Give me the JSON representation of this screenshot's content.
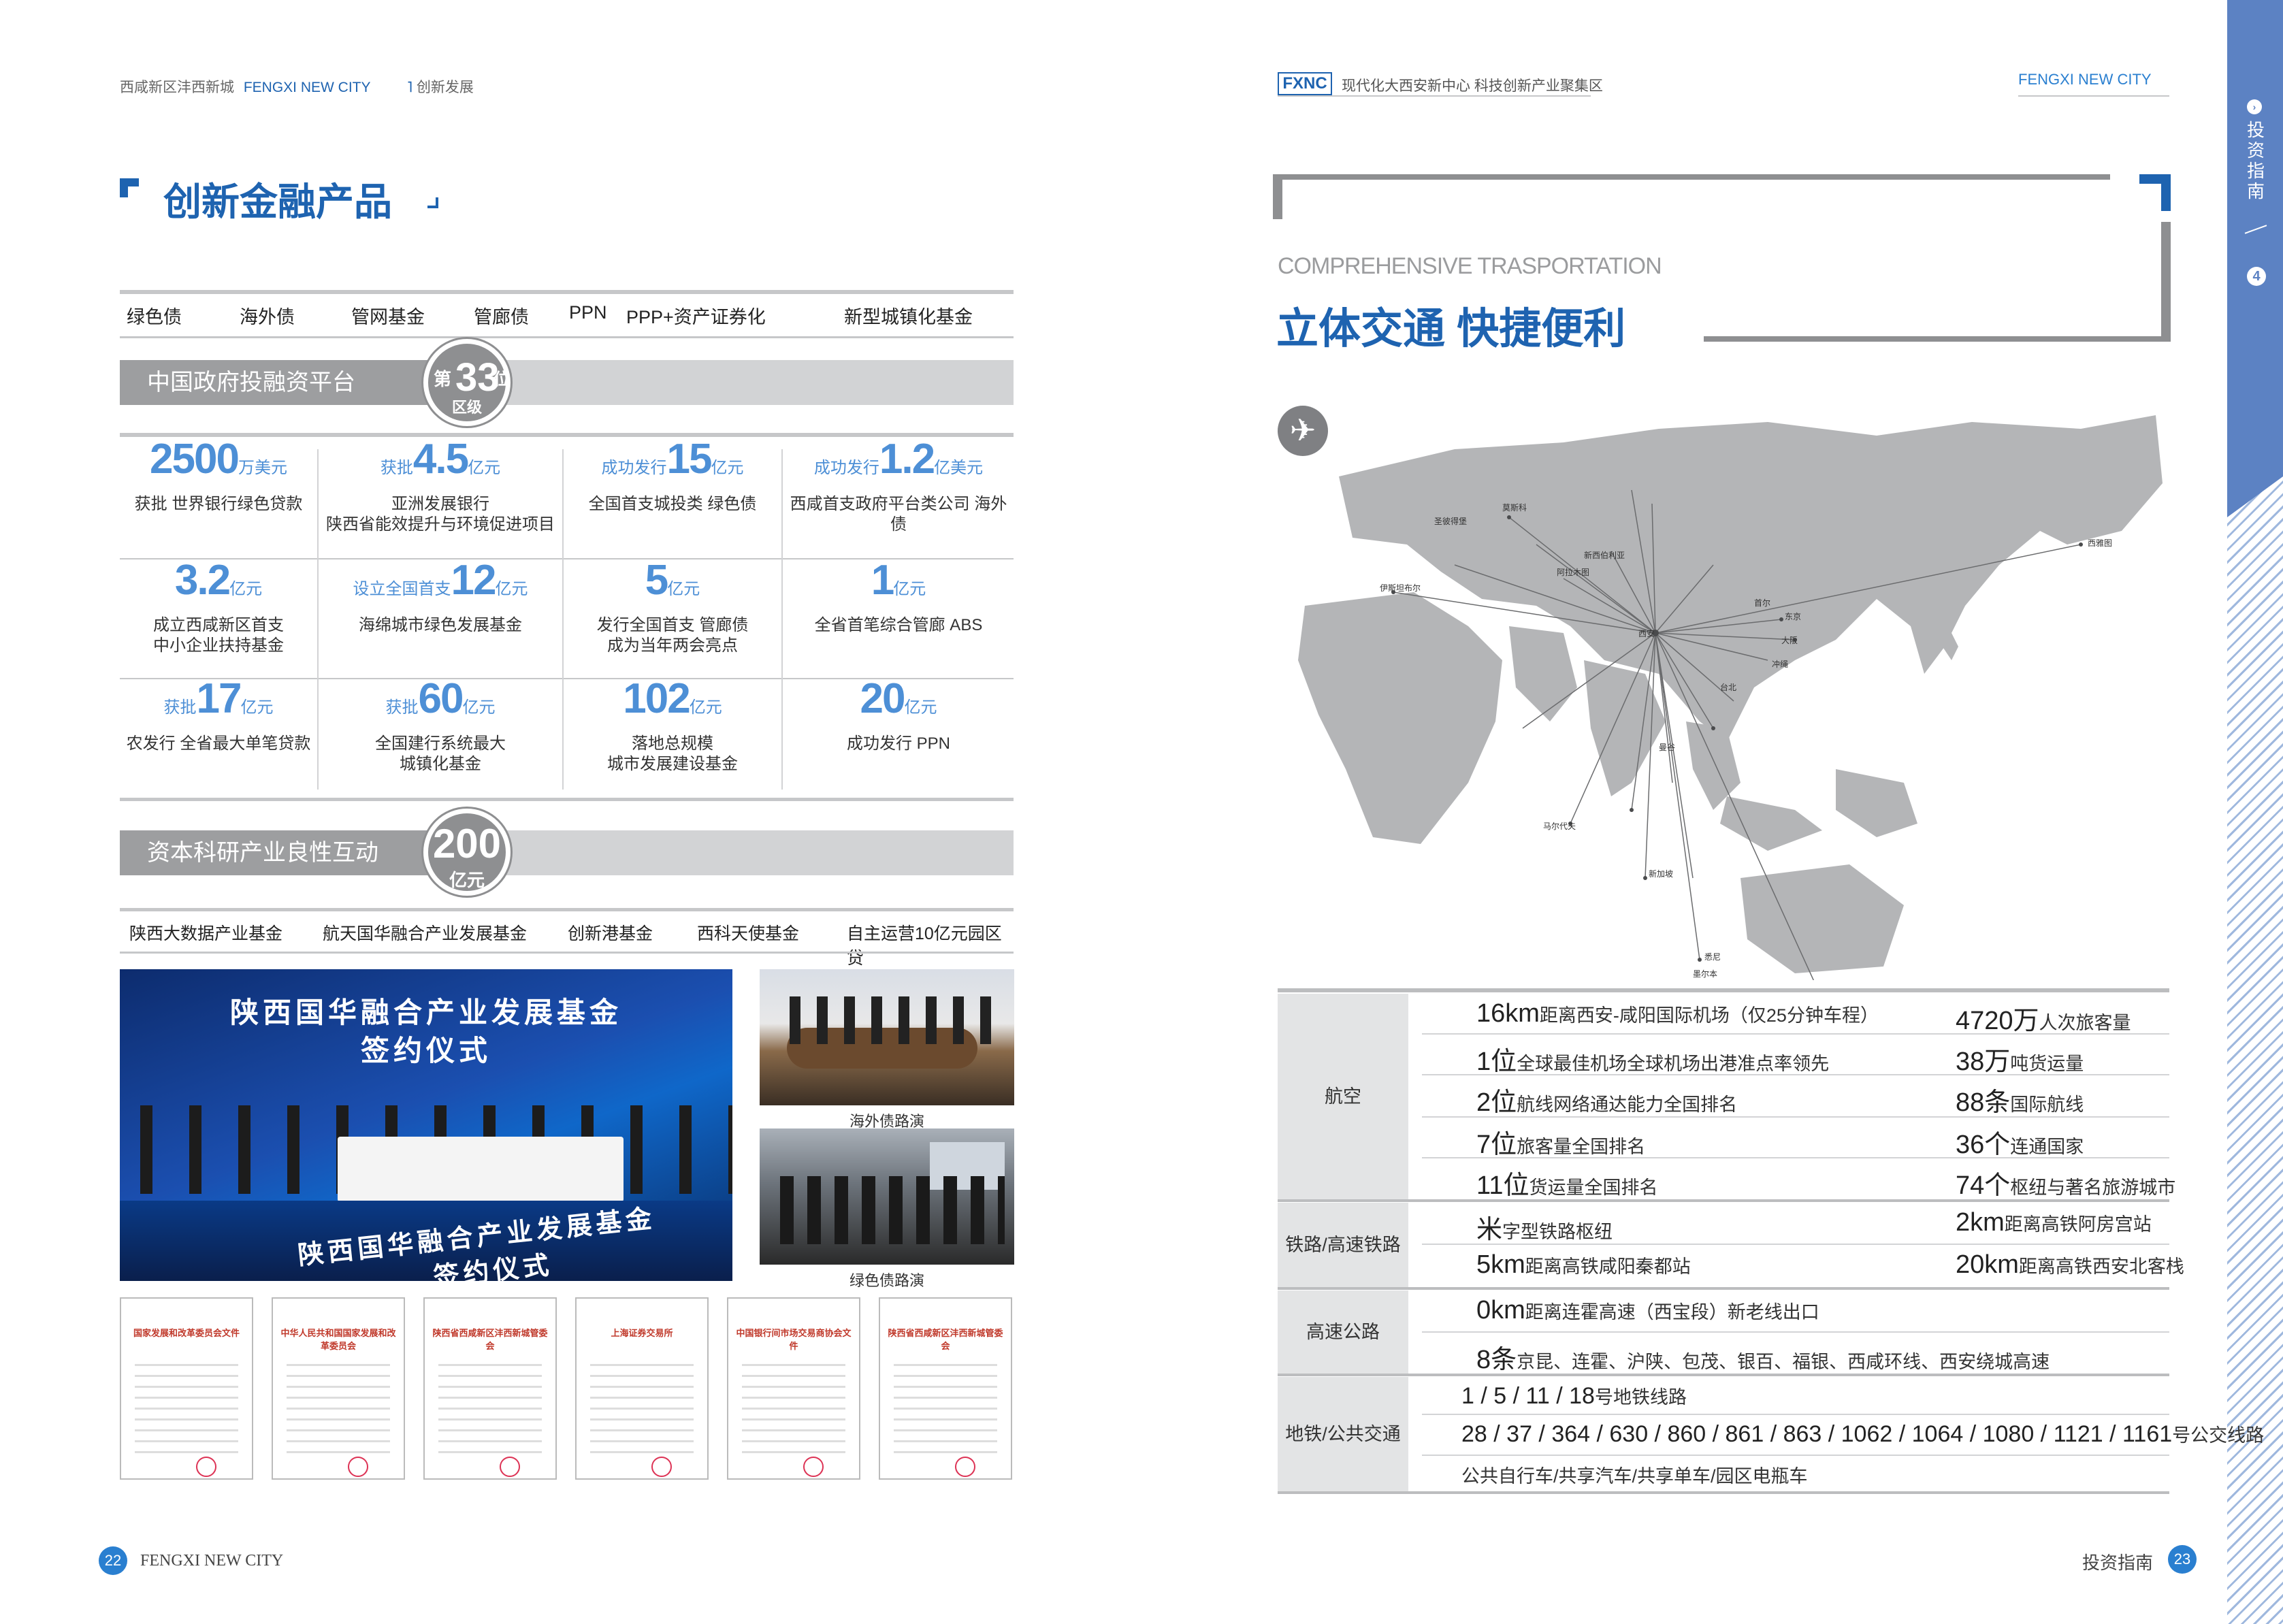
{
  "left": {
    "header": {
      "area": "西咸新区沣西新城",
      "brand": "FENGXI NEW CITY",
      "section": "创新发展"
    },
    "title": "创新金融产品",
    "tags": [
      "绿色债",
      "海外债",
      "管网基金",
      "管廊债",
      "PPN",
      "PPP+资产证券化",
      "新型城镇化基金"
    ],
    "platform": {
      "label": "中国政府投融资平台",
      "rank_prefix": "第",
      "rank": "33",
      "rank_suffix": "位",
      "rank_sub": "区级"
    },
    "stats": [
      {
        "pre": "",
        "num": "2500",
        "unit": "万美元",
        "l1": "获批 世界银行绿色贷款",
        "l2": "",
        "l3": ""
      },
      {
        "pre": "获批",
        "num": "4.5",
        "unit": "亿元",
        "l1": "亚洲发展银行",
        "l2": "陕西省能效提升与环境促进项目",
        "l3": ""
      },
      {
        "pre": "成功发行",
        "num": "15",
        "unit": "亿元",
        "l1": "全国首支城投类 绿色债",
        "l2": "",
        "l3": ""
      },
      {
        "pre": "成功发行",
        "num": "1.2",
        "unit": "亿美元",
        "l1": "西咸首支政府平台类公司 海外债",
        "l2": "",
        "l3": ""
      },
      {
        "pre": "",
        "num": "3.2",
        "unit": "亿元",
        "l1": "成立西咸新区首支",
        "l2": "中小企业扶持基金",
        "l3": ""
      },
      {
        "pre": "设立全国首支",
        "num": "12",
        "unit": "亿元",
        "l1": "海绵城市绿色发展基金",
        "l2": "",
        "l3": ""
      },
      {
        "pre": "",
        "num": "5",
        "unit": "亿元",
        "l1": "发行全国首支 管廊债",
        "l2": "成为当年两会亮点",
        "l3": ""
      },
      {
        "pre": "",
        "num": "1",
        "unit": "亿元",
        "l1": "全省首笔综合管廊 ABS",
        "l2": "",
        "l3": ""
      },
      {
        "pre": "获批",
        "num": "17",
        "unit": "亿元",
        "l1": "农发行 全省最大单笔贷款",
        "l2": "",
        "l3": ""
      },
      {
        "pre": "获批",
        "num": "60",
        "unit": "亿元",
        "l1": "全国建行系统最大",
        "l2": "城镇化基金",
        "l3": ""
      },
      {
        "pre": "",
        "num": "102",
        "unit": "亿元",
        "l1": "落地总规模",
        "l2": "城市发展建设基金",
        "l3": ""
      },
      {
        "pre": "",
        "num": "20",
        "unit": "亿元",
        "l1": "成功发行 PPN",
        "l2": "",
        "l3": ""
      }
    ],
    "capital": {
      "label": "资本科研产业良性互动",
      "amount": "200",
      "amount_unit": "亿元"
    },
    "funds": [
      "陕西大数据产业基金",
      "航天国华融合产业发展基金",
      "创新港基金",
      "西科天使基金",
      "自主运营10亿元园区贷"
    ],
    "photo_main": {
      "line1": "陕西国华融合产业发展基金",
      "line2": "签约仪式"
    },
    "photo_captions": [
      "海外债路演",
      "绿色债路演"
    ],
    "docs": [
      "国家发展和改革委员会文件",
      "中华人民共和国国家发展和改革委员会",
      "陕西省西咸新区沣西新城管委会",
      "上海证券交易所",
      "中国银行间市场交易商协会文件",
      "陕西省西咸新区沣西新城管委会"
    ],
    "footer": {
      "page": "22",
      "brand": "FENGXI NEW CITY"
    }
  },
  "right": {
    "header": {
      "logo": "FXNC",
      "tagline": "现代化大西安新中心  科技创新产业聚集区",
      "brand": "FENGXI NEW CITY"
    },
    "side_tab": {
      "label": "投资指南",
      "num": "4"
    },
    "subtitle": "COMPREHENSIVE TRASPORTATION",
    "title": "立体交通 快捷便利",
    "map_cities": [
      "莫斯科",
      "新西伯利亚",
      "圣彼得堡",
      "阿拉木图",
      "伊斯坦布尔",
      "西安",
      "东京",
      "大阪",
      "首尔",
      "冲绳",
      "台北",
      "曼谷",
      "新加坡",
      "悉尼",
      "墨尔本",
      "马尔代夫",
      "西雅图"
    ],
    "table": [
      {
        "cat": "航空",
        "rows": [
          [
            {
              "n": "16km",
              "t": "距离西安-咸阳国际机场（仅25分钟车程）"
            },
            {
              "n": "4720万",
              "t": "人次旅客量"
            }
          ],
          [
            {
              "n": "1位",
              "t": "全球最佳机场全球机场出港准点率领先"
            },
            {
              "n": "38万",
              "t": "吨货运量"
            }
          ],
          [
            {
              "n": "2位",
              "t": "航线网络通达能力全国排名"
            },
            {
              "n": "88条",
              "t": "国际航线"
            }
          ],
          [
            {
              "n": "7位",
              "t": "旅客量全国排名"
            },
            {
              "n": "36个",
              "t": "连通国家"
            }
          ],
          [
            {
              "n": "11位",
              "t": "货运量全国排名"
            },
            {
              "n": "74个",
              "t": "枢纽与著名旅游城市"
            }
          ]
        ]
      },
      {
        "cat": "铁路/高速铁路",
        "rows": [
          [
            {
              "n": "米",
              "t": "字型铁路枢纽"
            },
            {
              "n": "2km",
              "t": "距离高铁阿房宫站"
            }
          ],
          [
            {
              "n": "5km",
              "t": "距离高铁咸阳秦都站"
            },
            {
              "n": "20km",
              "t": "距离高铁西安北客栈"
            }
          ]
        ]
      },
      {
        "cat": "高速公路",
        "rows": [
          [
            {
              "n": "0km",
              "t": "距离连霍高速（西宝段）新老线出口"
            }
          ],
          [
            {
              "n": "8条",
              "t": "京昆、连霍、沪陕、包茂、银百、福银、西咸环线、西安绕城高速"
            }
          ]
        ]
      },
      {
        "cat": "地铁/公共交通",
        "rows": [
          [
            {
              "n": "1 / 5 / 11 / 18",
              "t": "号地铁线路"
            }
          ],
          [
            {
              "n": "28 / 37 / 364 / 630 / 860 / 861 / 863 / 1062 / 1064 / 1080 / 1121 / 1161",
              "t": "号公交线路"
            }
          ],
          [
            {
              "n": "",
              "t": "公共自行车/共享汽车/共享单车/园区电瓶车"
            }
          ]
        ]
      }
    ],
    "footer": {
      "label": "投资指南",
      "page": "23"
    }
  }
}
